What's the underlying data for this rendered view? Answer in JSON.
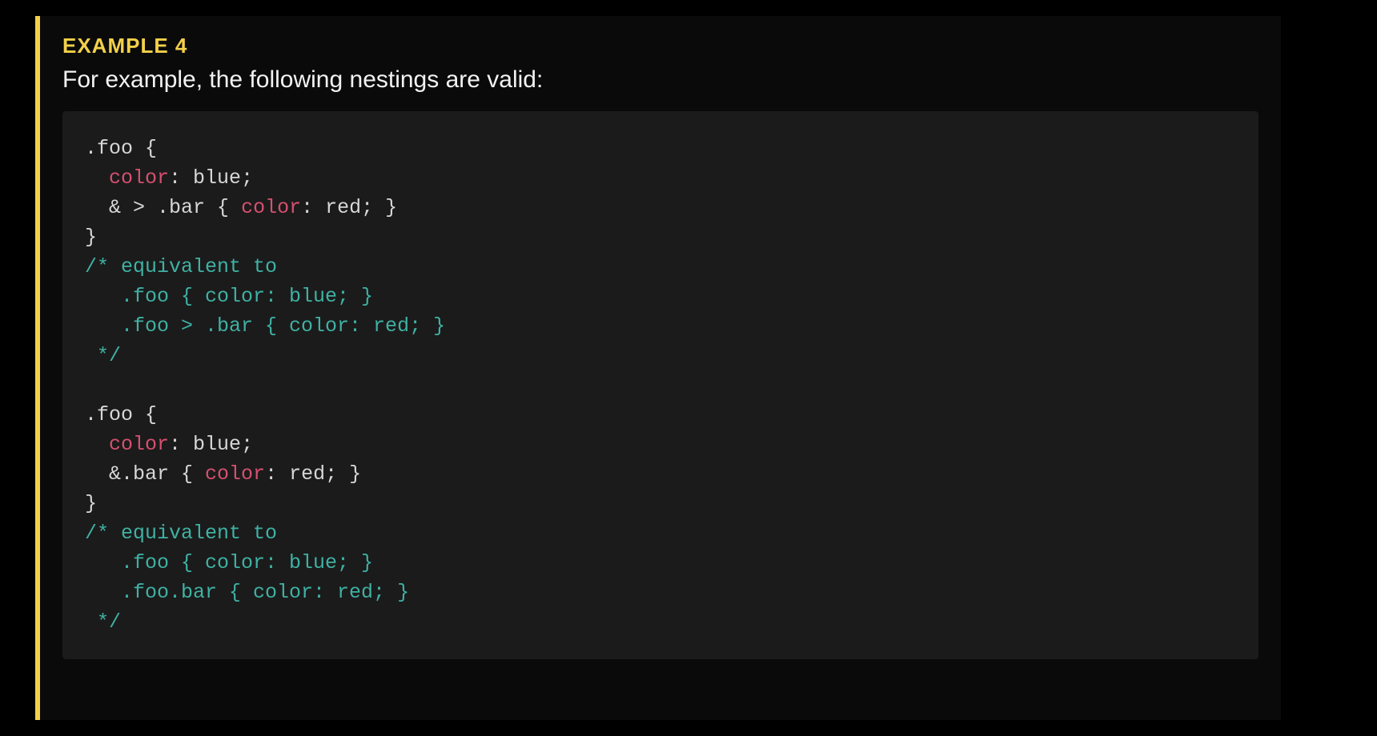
{
  "header": {
    "label": "EXAMPLE 4",
    "description": "For example, the following nestings are valid:"
  },
  "code": {
    "block1": {
      "line1_sel": ".foo ",
      "line1_brace": "{",
      "line2_indent": "  ",
      "line2_prop": "color",
      "line2_colon": ": ",
      "line2_val": "blue",
      "line2_semi": ";",
      "line3_indent": "  ",
      "line3_sel": "& > .bar ",
      "line3_open": "{ ",
      "line3_prop": "color",
      "line3_colon": ": ",
      "line3_val": "red",
      "line3_close": "; }",
      "line4_brace": "}",
      "comment1_l1": "/* equivalent to",
      "comment1_l2": "   .foo { color: blue; }",
      "comment1_l3": "   .foo > .bar { color: red; }",
      "comment1_l4": " */"
    },
    "block2": {
      "line1_sel": ".foo ",
      "line1_brace": "{",
      "line2_indent": "  ",
      "line2_prop": "color",
      "line2_colon": ": ",
      "line2_val": "blue",
      "line2_semi": ";",
      "line3_indent": "  ",
      "line3_sel": "&.bar ",
      "line3_open": "{ ",
      "line3_prop": "color",
      "line3_colon": ": ",
      "line3_val": "red",
      "line3_close": "; }",
      "line4_brace": "}",
      "comment2_l1": "/* equivalent to",
      "comment2_l2": "   .foo { color: blue; }",
      "comment2_l3": "   .foo.bar { color: red; }",
      "comment2_l4": " */"
    }
  }
}
